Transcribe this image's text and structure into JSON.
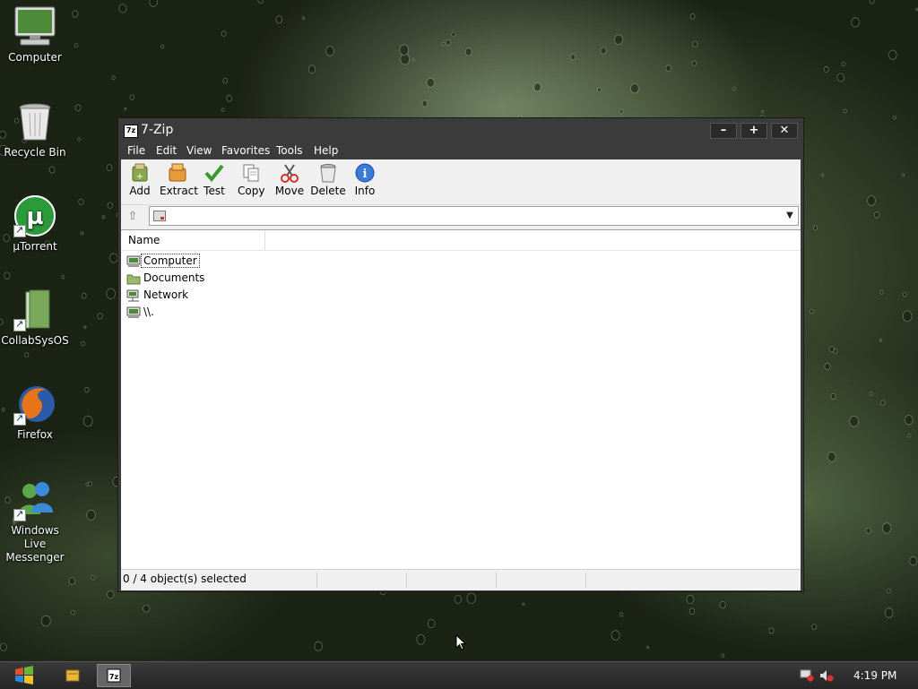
{
  "desktop": {
    "icons": [
      {
        "label": "Computer",
        "icon": "computer-icon"
      },
      {
        "label": "Recycle Bin",
        "icon": "recycle-bin-icon"
      },
      {
        "label": "µTorrent",
        "icon": "utorrent-icon"
      },
      {
        "label": "CollabSysOS",
        "icon": "folder-icon"
      },
      {
        "label": "Firefox",
        "icon": "firefox-icon"
      },
      {
        "label": "Windows Live Messenger",
        "icon": "messenger-icon"
      }
    ]
  },
  "window": {
    "title": "7-Zip",
    "app_icon_text": "7z",
    "controls": {
      "minimize": "–",
      "maximize": "+",
      "close": "✕"
    },
    "menu": [
      "File",
      "Edit",
      "View",
      "Favorites",
      "Tools",
      "Help"
    ],
    "toolbar": [
      {
        "label": "Add",
        "icon": "add-icon"
      },
      {
        "label": "Extract",
        "icon": "extract-icon"
      },
      {
        "label": "Test",
        "icon": "test-checkmark-icon"
      },
      {
        "label": "Copy",
        "icon": "copy-icon"
      },
      {
        "label": "Move",
        "icon": "move-scissors-icon"
      },
      {
        "label": "Delete",
        "icon": "delete-icon"
      },
      {
        "label": "Info",
        "icon": "info-icon"
      }
    ],
    "address": {
      "value": ""
    },
    "list": {
      "columns": [
        "Name"
      ],
      "items": [
        {
          "name": "Computer",
          "icon": "computer-icon"
        },
        {
          "name": "Documents",
          "icon": "folder-icon"
        },
        {
          "name": "Network",
          "icon": "network-icon"
        },
        {
          "name": "\\\\.",
          "icon": "computer-icon"
        }
      ]
    },
    "status": {
      "selection": "0 / 4 object(s) selected"
    }
  },
  "taskbar": {
    "clock": "4:19 PM",
    "items": [
      "start-windows-icon",
      "file-manager-icon",
      "7zip-icon"
    ]
  }
}
